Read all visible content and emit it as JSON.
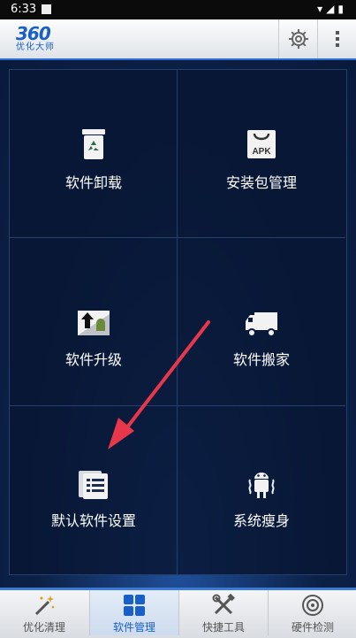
{
  "status": {
    "time": "6:33"
  },
  "header": {
    "logo_num": "360",
    "logo_sub": "优化大师"
  },
  "tiles": [
    {
      "label": "软件卸载",
      "icon": "recycle-bin-icon"
    },
    {
      "label": "安装包管理",
      "icon": "apk-bag-icon"
    },
    {
      "label": "软件升级",
      "icon": "upgrade-icon"
    },
    {
      "label": "软件搬家",
      "icon": "truck-icon"
    },
    {
      "label": "默认软件设置",
      "icon": "list-settings-icon"
    },
    {
      "label": "系统瘦身",
      "icon": "android-slim-icon"
    }
  ],
  "tile_text": {
    "apk": "APK"
  },
  "bottom_nav": [
    {
      "label": "优化清理",
      "icon": "magic-wand-icon",
      "active": false
    },
    {
      "label": "软件管理",
      "icon": "grid-apps-icon",
      "active": true
    },
    {
      "label": "快捷工具",
      "icon": "tools-icon",
      "active": false
    },
    {
      "label": "硬件检测",
      "icon": "disc-icon",
      "active": false
    }
  ],
  "colors": {
    "accent": "#1a5fc8",
    "arrow": "#e8374a",
    "background": "#0a1a3c"
  }
}
